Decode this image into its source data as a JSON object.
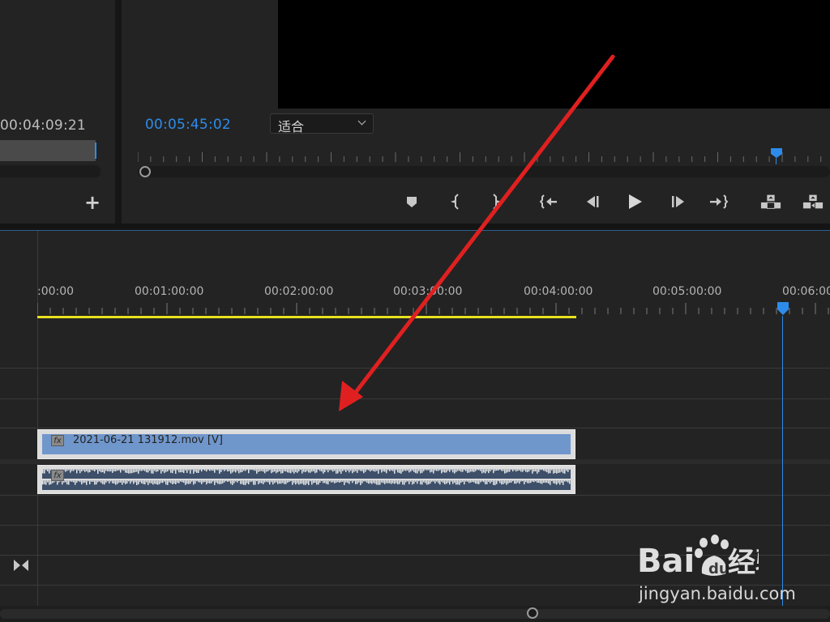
{
  "source_monitor": {
    "timecode": "00:04:09:21",
    "add_button": "+"
  },
  "program_monitor": {
    "timecode": "00:05:45:02",
    "zoom": {
      "selected": "适合"
    },
    "controls": [
      {
        "name": "add-marker-button",
        "icon": "marker-icon"
      },
      {
        "name": "mark-in-button",
        "icon": "bracket-in-icon"
      },
      {
        "name": "mark-out-button",
        "icon": "bracket-out-icon"
      },
      {
        "name": "go-to-in-button",
        "icon": "go-to-in-icon"
      },
      {
        "name": "step-back-button",
        "icon": "step-back-icon"
      },
      {
        "name": "play-button",
        "icon": "play-icon"
      },
      {
        "name": "step-forward-button",
        "icon": "step-forward-icon"
      },
      {
        "name": "go-to-out-button",
        "icon": "go-to-out-icon"
      },
      {
        "name": "lift-button",
        "icon": "lift-icon"
      },
      {
        "name": "extract-button",
        "icon": "extract-icon"
      }
    ]
  },
  "timeline": {
    "ruler_labels": [
      ":00:00",
      "00:01:00:00",
      "00:02:00:00",
      "00:03:00:00",
      "00:04:00:00",
      "00:05:00:00",
      "00:06:00"
    ],
    "video_clip": {
      "fx": "fx",
      "name": "2021-06-21 131912.mov [V]"
    },
    "audio_clip": {
      "fx": "fx"
    }
  },
  "watermark": {
    "brand": "Bai经验",
    "url": "jingyan.baidu.com"
  },
  "colors": {
    "accent_blue": "#2d8ceb",
    "work_area_yellow": "#e7e01f",
    "video_clip": "#7097cc",
    "annotation_arrow": "#e02020"
  }
}
